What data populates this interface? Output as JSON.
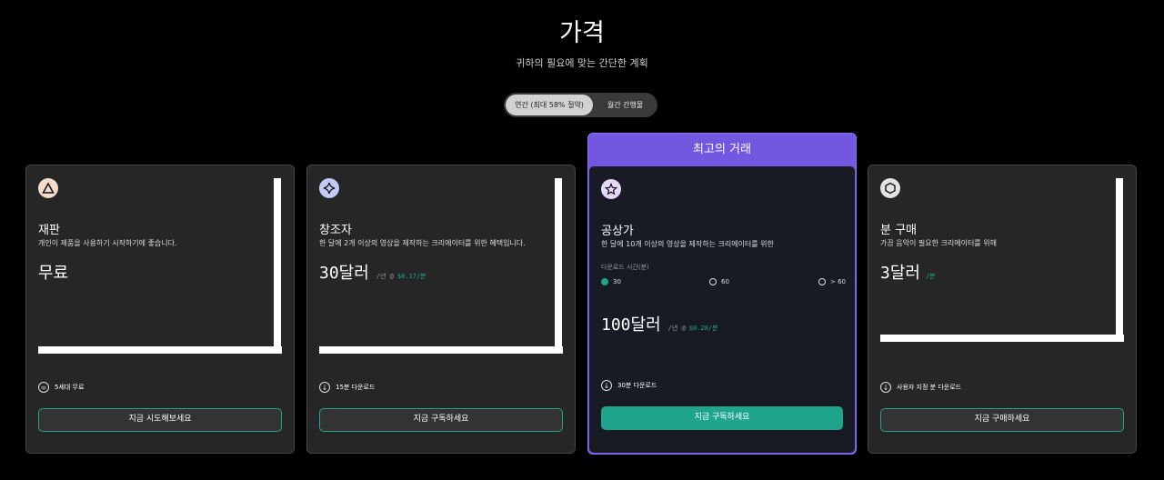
{
  "header": {
    "title": "가격",
    "subtitle": "귀하의 필요에 맞는 간단한 계획"
  },
  "billing_toggle": {
    "annual": "연간 (최대 58% 절약)",
    "monthly": "월간 간행물",
    "selected": "annual"
  },
  "plans": [
    {
      "name": "재판",
      "icon": "triangle-icon",
      "icon_bg": "#f3dcc9",
      "description": "개인이 제품을 사용하기 시작하기에 좋습니다.",
      "price": "무료",
      "feature": "5세대 무료",
      "feature_icon": "infinity-icon",
      "button": "지금 시도해보세요"
    },
    {
      "name": "창조자",
      "icon": "sparkle-icon",
      "icon_bg": "#c4c9f5",
      "description": "한 달에 2개 이상의 영상을 제작하는 크리에이터를 위한 혜택입니다.",
      "price": "30달러",
      "unit": "/년 @",
      "rate": "$0.17/분",
      "feature": "15분 다운로드",
      "feature_icon": "download-icon",
      "button": "지금 구독하세요"
    },
    {
      "name": "공상가",
      "banner": "최고의 거래",
      "icon": "star-icon",
      "icon_bg": "#e4d9f7",
      "description": "한 달에 10개 이상의 영상을 제작하는 크리에이터를 위한",
      "download_label": "다운로드 시간(분)",
      "options": [
        "30",
        "60",
        "> 60"
      ],
      "selected_option": "30",
      "price": "100달러",
      "unit": "/년 @",
      "rate": "$0.28/분",
      "feature": "30분 다운로드",
      "feature_icon": "download-icon",
      "button": "지금 구독하세요"
    },
    {
      "name": "분 구매",
      "icon": "hexagon-icon",
      "icon_bg": "#e3e3e3",
      "description": "가끔 음악이 필요한 크리에이터를 위해",
      "price": "3달러",
      "rate": "/분",
      "feature": "사용자 지정 분 다운로드",
      "feature_icon": "download-icon",
      "button": "지금 구매하세요"
    }
  ]
}
